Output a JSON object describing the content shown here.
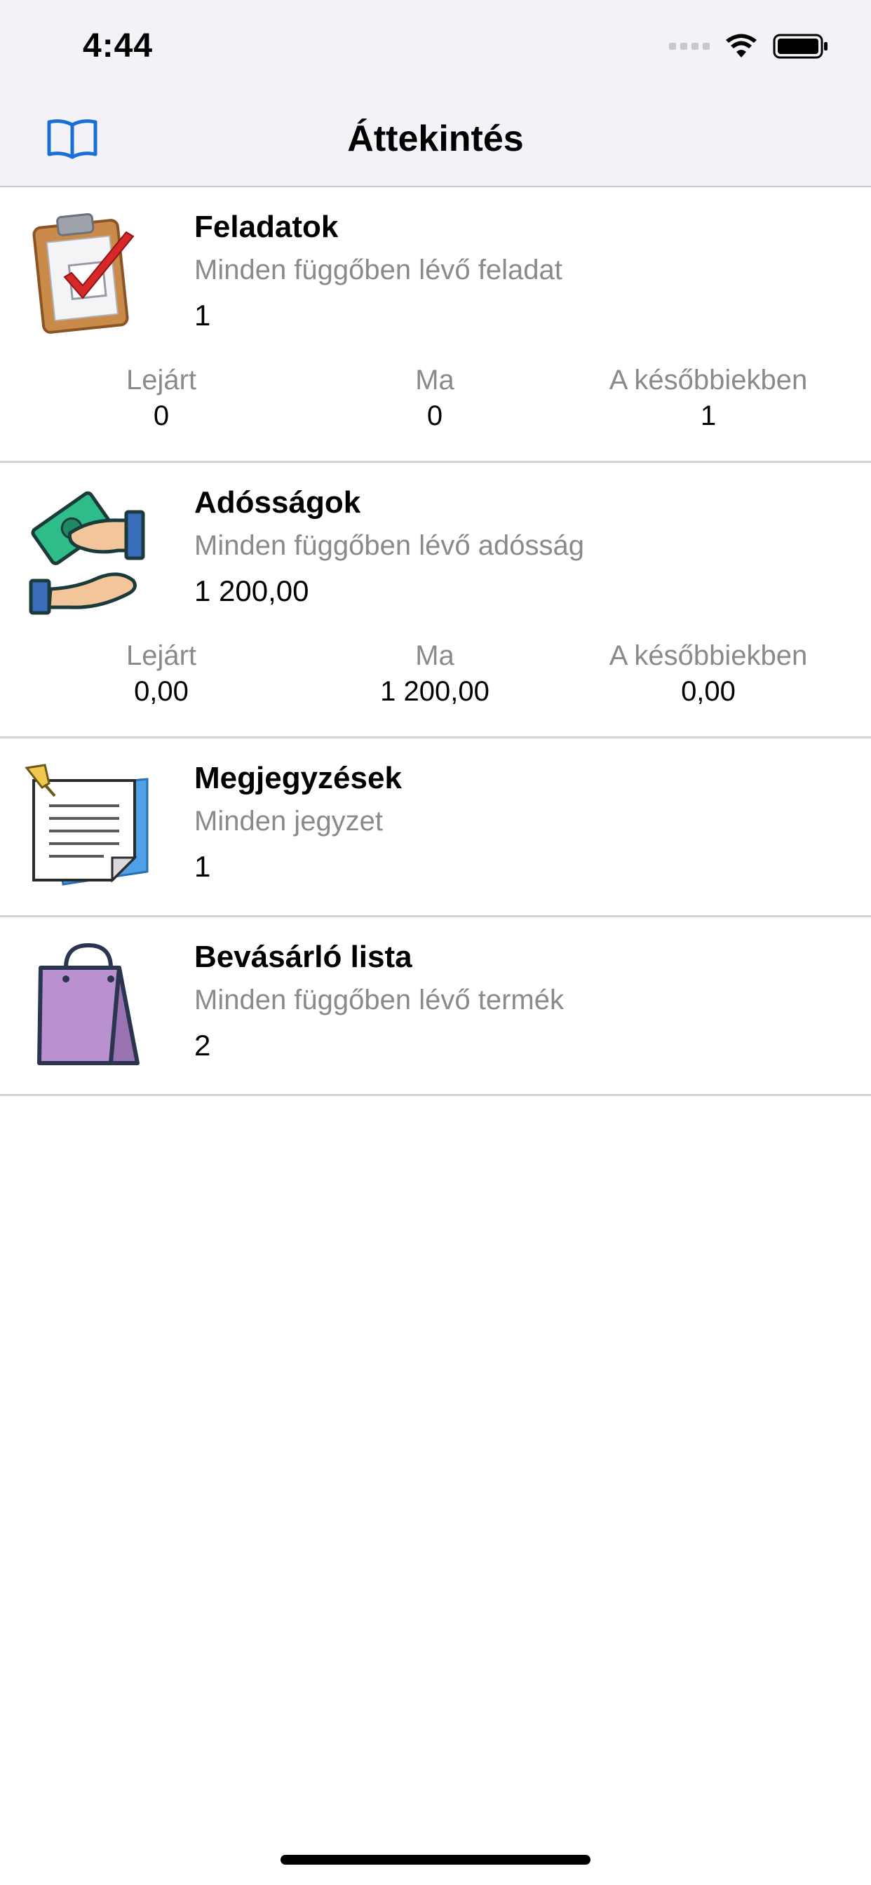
{
  "status_bar": {
    "time": "4:44"
  },
  "nav": {
    "title": "Áttekintés",
    "left_icon": "book-icon"
  },
  "colors": {
    "accent": "#1a6fd6",
    "secondary_text": "#8a8a8e",
    "separator": "#d1d1d6",
    "nav_background": "#f2f2f7"
  },
  "rows": [
    {
      "title": "Feladatok",
      "subtitle": "Minden függőben lévő feladat",
      "value": "1",
      "icon": "clipboard-check-icon",
      "stats": [
        {
          "label": "Lejárt",
          "value": "0"
        },
        {
          "label": "Ma",
          "value": "0"
        },
        {
          "label": "A későbbiekben",
          "value": "1"
        }
      ]
    },
    {
      "title": "Adósságok",
      "subtitle": "Minden függőben lévő adósság",
      "value": "1 200,00",
      "icon": "money-hands-icon",
      "stats": [
        {
          "label": "Lejárt",
          "value": "0,00"
        },
        {
          "label": "Ma",
          "value": "1 200,00"
        },
        {
          "label": "A későbbiekben",
          "value": "0,00"
        }
      ]
    },
    {
      "title": "Megjegyzések",
      "subtitle": "Minden jegyzet",
      "value": "1",
      "icon": "note-pin-icon"
    },
    {
      "title": "Bevásárló lista",
      "subtitle": "Minden függőben lévő termék",
      "value": "2",
      "icon": "shopping-bag-icon"
    }
  ]
}
